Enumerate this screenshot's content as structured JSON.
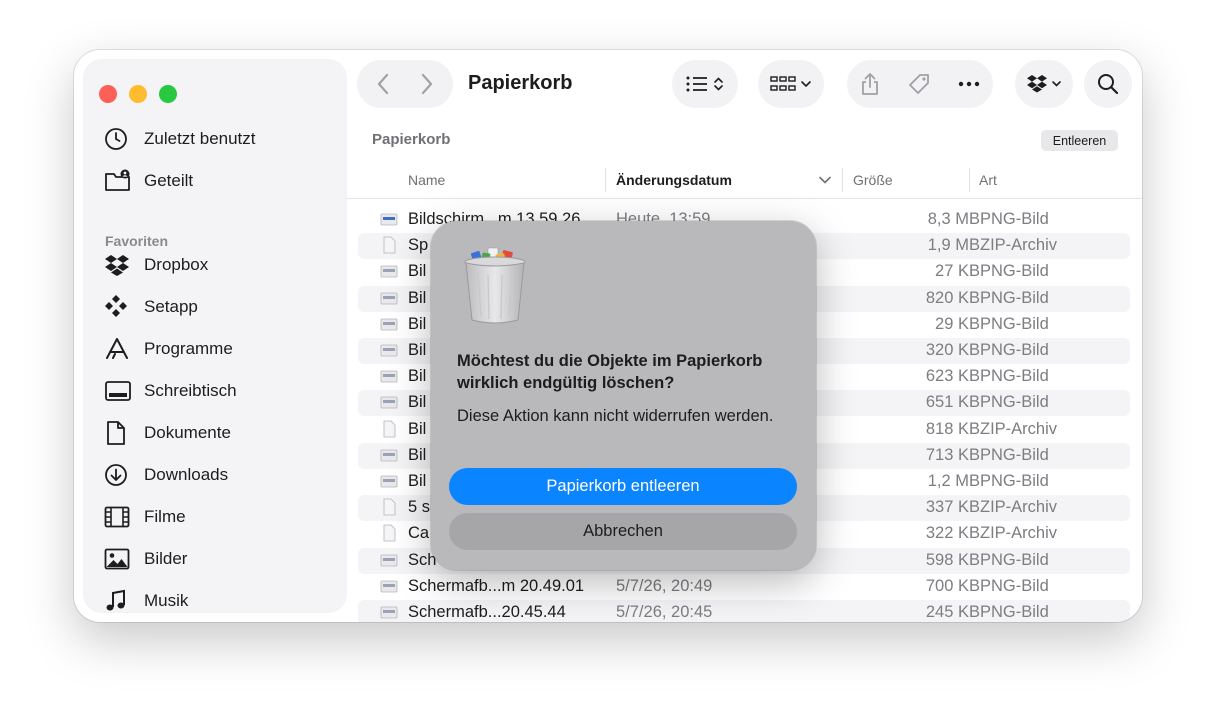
{
  "window": {
    "title": "Papierkorb"
  },
  "sidebar": {
    "items_top": [
      {
        "label": "Zuletzt benutzt",
        "icon": "clock-icon"
      },
      {
        "label": "Geteilt",
        "icon": "shared-folder-icon"
      }
    ],
    "favorites_label": "Favoriten",
    "favorites": [
      {
        "label": "Dropbox",
        "icon": "dropbox-icon"
      },
      {
        "label": "Setapp",
        "icon": "setapp-icon"
      },
      {
        "label": "Programme",
        "icon": "applications-icon"
      },
      {
        "label": "Schreibtisch",
        "icon": "desktop-icon"
      },
      {
        "label": "Dokumente",
        "icon": "document-icon"
      },
      {
        "label": "Downloads",
        "icon": "download-icon"
      },
      {
        "label": "Filme",
        "icon": "film-icon"
      },
      {
        "label": "Bilder",
        "icon": "photo-icon"
      },
      {
        "label": "Musik",
        "icon": "music-icon"
      }
    ]
  },
  "content": {
    "path_label": "Papierkorb",
    "empty_button": "Entleeren",
    "columns": {
      "name": "Name",
      "date": "Änderungsdatum",
      "size": "Größe",
      "kind": "Art"
    },
    "rows": [
      {
        "name": "Bildschirm...m 13.59.26",
        "date": "Heute, 13:59",
        "size": "8,3 MB",
        "kind": "PNG-Bild"
      },
      {
        "name": "Sp",
        "date": "",
        "size": "1,9 MB",
        "kind": "ZIP-Archiv"
      },
      {
        "name": "Bil",
        "date": "",
        "size": "27 KB",
        "kind": "PNG-Bild"
      },
      {
        "name": "Bil",
        "date": "",
        "size": "820 KB",
        "kind": "PNG-Bild"
      },
      {
        "name": "Bil",
        "date": "",
        "size": "29 KB",
        "kind": "PNG-Bild"
      },
      {
        "name": "Bil",
        "date": "",
        "size": "320 KB",
        "kind": "PNG-Bild"
      },
      {
        "name": "Bil",
        "date": "",
        "size": "623 KB",
        "kind": "PNG-Bild"
      },
      {
        "name": "Bil",
        "date": "",
        "size": "651 KB",
        "kind": "PNG-Bild"
      },
      {
        "name": "Bil",
        "date": "",
        "size": "818 KB",
        "kind": "ZIP-Archiv"
      },
      {
        "name": "Bil",
        "date": "",
        "size": "713 KB",
        "kind": "PNG-Bild"
      },
      {
        "name": "Bil",
        "date": "",
        "size": "1,2 MB",
        "kind": "PNG-Bild"
      },
      {
        "name": "5 s",
        "date": "",
        "size": "337 KB",
        "kind": "ZIP-Archiv"
      },
      {
        "name": "Ca",
        "date": "",
        "size": "322 KB",
        "kind": "ZIP-Archiv"
      },
      {
        "name": "Sch",
        "date": "",
        "size": "598 KB",
        "kind": "PNG-Bild"
      },
      {
        "name": "Schermafb...m 20.49.01",
        "date": "5/7/26, 20:49",
        "size": "700 KB",
        "kind": "PNG-Bild"
      },
      {
        "name": "Schermafb...20.45.44",
        "date": "5/7/26, 20:45",
        "size": "245 KB",
        "kind": "PNG-Bild"
      }
    ]
  },
  "dialog": {
    "title": "Möchtest du die Objekte im Papierkorb wirklich endgültig löschen?",
    "message": "Diese Aktion kann nicht widerrufen werden.",
    "confirm_label": "Papierkorb entleeren",
    "cancel_label": "Abbrechen"
  },
  "colors": {
    "accent": "#0a84ff",
    "close": "#fe5f57",
    "minimize": "#febc2e",
    "zoom": "#28c840"
  }
}
